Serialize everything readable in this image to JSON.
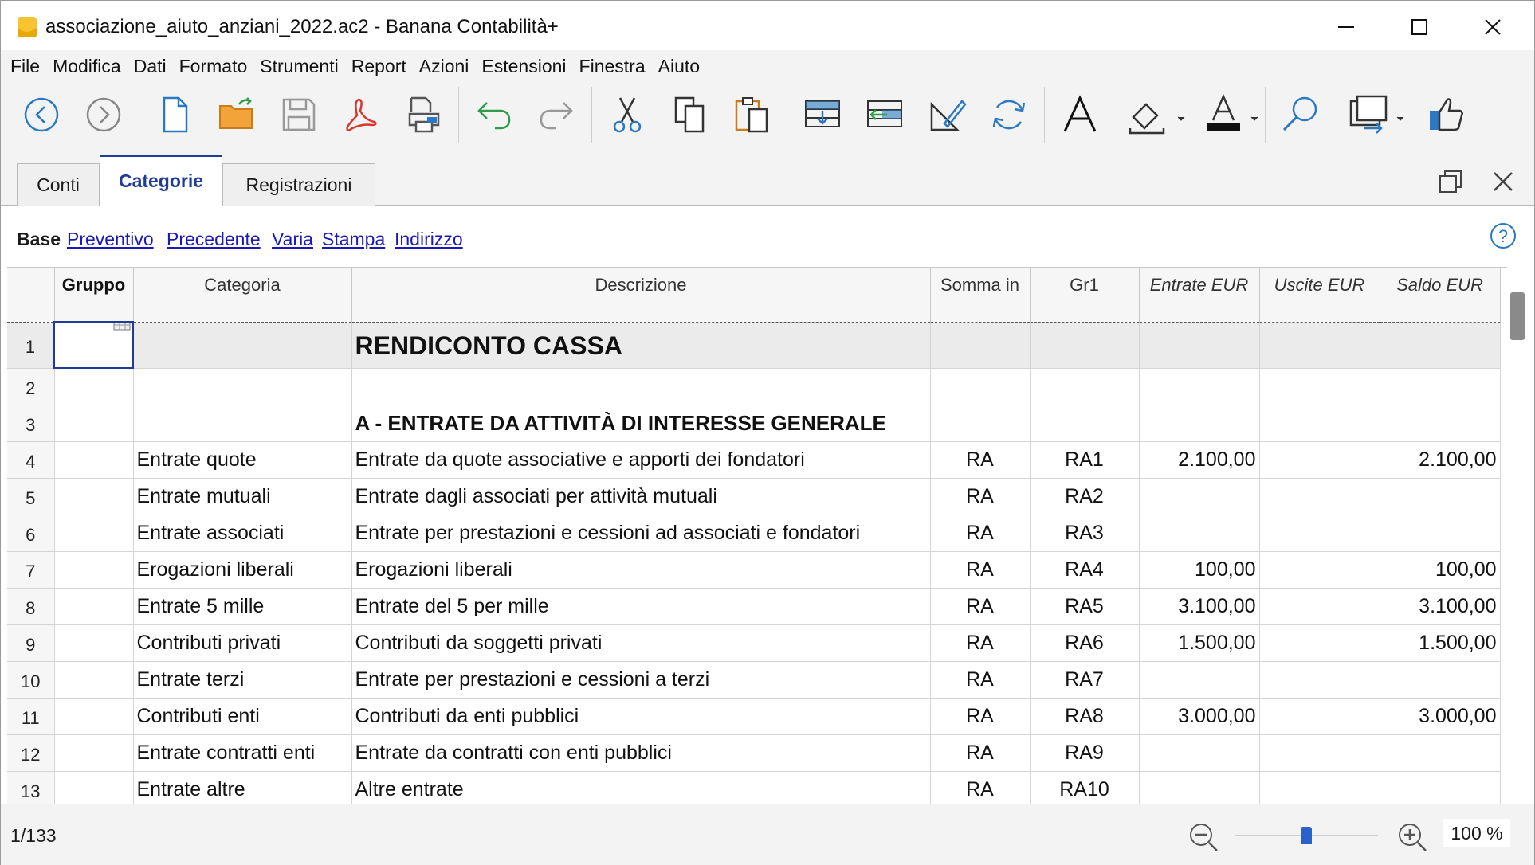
{
  "window": {
    "title": "associazione_aiuto_anziani_2022.ac2 - Banana Contabilità+"
  },
  "menu": [
    "File",
    "Modifica",
    "Dati",
    "Formato",
    "Strumenti",
    "Report",
    "Azioni",
    "Estensioni",
    "Finestra",
    "Aiuto"
  ],
  "toolbar_icons": [
    "back-icon",
    "forward-icon",
    "new-file-icon",
    "open-folder-icon",
    "save-icon",
    "pdf-icon",
    "print-icon",
    "undo-icon",
    "redo-icon",
    "cut-icon",
    "copy-icon",
    "paste-icon",
    "insert-rows-icon",
    "move-rows-icon",
    "edit-cell-icon",
    "recalculate-icon",
    "font-icon",
    "fill-color-icon",
    "text-color-icon",
    "find-icon",
    "extract-icon",
    "feedback-icon"
  ],
  "tabs": [
    "Conti",
    "Categorie",
    "Registrazioni"
  ],
  "active_tab": "Categorie",
  "views": {
    "active": "Base",
    "links": [
      "Preventivo",
      "Precedente",
      "Varia",
      "Stampa",
      "Indirizzo"
    ]
  },
  "columns": [
    "Gruppo",
    "Categoria",
    "Descrizione",
    "Somma in",
    "Gr1",
    "Entrate EUR",
    "Uscite EUR",
    "Saldo EUR"
  ],
  "rows": [
    {
      "n": "1",
      "gruppo": "",
      "categoria": "",
      "descrizione": "RENDICONTO CASSA",
      "somma": "",
      "gr1": "",
      "entrate": "",
      "uscite": "",
      "saldo": ""
    },
    {
      "n": "2",
      "gruppo": "",
      "categoria": "",
      "descrizione": "",
      "somma": "",
      "gr1": "",
      "entrate": "",
      "uscite": "",
      "saldo": ""
    },
    {
      "n": "3",
      "gruppo": "",
      "categoria": "",
      "descrizione": "A - ENTRATE DA ATTIVITÀ DI INTERESSE GENERALE",
      "somma": "",
      "gr1": "",
      "entrate": "",
      "uscite": "",
      "saldo": ""
    },
    {
      "n": "4",
      "gruppo": "",
      "categoria": "Entrate quote",
      "descrizione": "Entrate da quote associative e apporti dei fondatori",
      "somma": "RA",
      "gr1": "RA1",
      "entrate": "2.100,00",
      "uscite": "",
      "saldo": "2.100,00"
    },
    {
      "n": "5",
      "gruppo": "",
      "categoria": "Entrate mutuali",
      "descrizione": "Entrate dagli associati per attività mutuali",
      "somma": "RA",
      "gr1": "RA2",
      "entrate": "",
      "uscite": "",
      "saldo": ""
    },
    {
      "n": "6",
      "gruppo": "",
      "categoria": "Entrate associati",
      "descrizione": "Entrate per prestazioni e cessioni ad associati e fondatori",
      "somma": "RA",
      "gr1": "RA3",
      "entrate": "",
      "uscite": "",
      "saldo": ""
    },
    {
      "n": "7",
      "gruppo": "",
      "categoria": "Erogazioni liberali",
      "descrizione": "Erogazioni liberali",
      "somma": "RA",
      "gr1": "RA4",
      "entrate": "100,00",
      "uscite": "",
      "saldo": "100,00"
    },
    {
      "n": "8",
      "gruppo": "",
      "categoria": "Entrate 5 mille",
      "descrizione": "Entrate del 5 per mille",
      "somma": "RA",
      "gr1": "RA5",
      "entrate": "3.100,00",
      "uscite": "",
      "saldo": "3.100,00"
    },
    {
      "n": "9",
      "gruppo": "",
      "categoria": "Contributi privati",
      "descrizione": "Contributi da soggetti privati",
      "somma": "RA",
      "gr1": "RA6",
      "entrate": "1.500,00",
      "uscite": "",
      "saldo": "1.500,00"
    },
    {
      "n": "10",
      "gruppo": "",
      "categoria": "Entrate terzi",
      "descrizione": "Entrate per prestazioni e cessioni a terzi",
      "somma": "RA",
      "gr1": "RA7",
      "entrate": "",
      "uscite": "",
      "saldo": ""
    },
    {
      "n": "11",
      "gruppo": "",
      "categoria": "Contributi enti",
      "descrizione": "Contributi da enti pubblici",
      "somma": "RA",
      "gr1": "RA8",
      "entrate": "3.000,00",
      "uscite": "",
      "saldo": "3.000,00"
    },
    {
      "n": "12",
      "gruppo": "",
      "categoria": "Entrate contratti enti",
      "descrizione": "Entrate da contratti con enti pubblici",
      "somma": "RA",
      "gr1": "RA9",
      "entrate": "",
      "uscite": "",
      "saldo": ""
    },
    {
      "n": "13",
      "gruppo": "",
      "categoria": "Entrate altre",
      "descrizione": "Altre entrate",
      "somma": "RA",
      "gr1": "RA10",
      "entrate": "",
      "uscite": "",
      "saldo": ""
    }
  ],
  "status": {
    "row_count": "1/133",
    "zoom": "100 %",
    "zoom_level": 100
  },
  "colors": {
    "accent": "#1f3c99",
    "link": "#1a1abb",
    "pdf": "#d9362b",
    "folder": "#f2a33a",
    "blue_icon": "#2b79c2"
  }
}
